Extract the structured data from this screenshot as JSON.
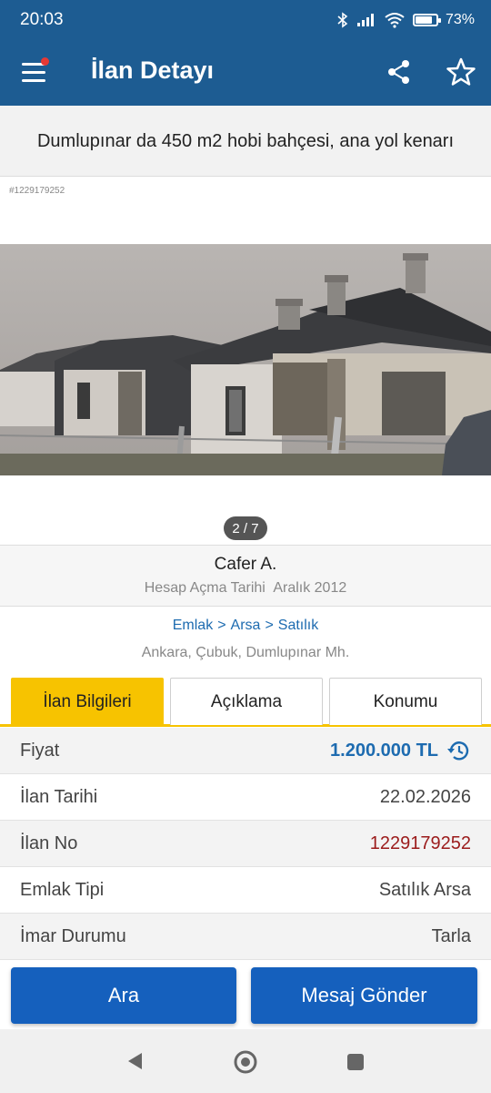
{
  "status_bar": {
    "time": "20:03",
    "battery": "73%"
  },
  "app_bar": {
    "title": "İlan Detayı"
  },
  "listing": {
    "title": "Dumlupınar da 450 m2 hobi bahçesi, ana yol kenarı",
    "id_tag": "#1229179252",
    "photo_counter": "2 / 7"
  },
  "seller": {
    "name": "Cafer A.",
    "since_label": "Hesap Açma Tarihi",
    "since_value": "Aralık 2012"
  },
  "breadcrumb": [
    "Emlak",
    "Arsa",
    "Satılık"
  ],
  "breadcrumb_sep": ">",
  "location": "Ankara, Çubuk, Dumlupınar Mh.",
  "tabs": [
    {
      "label": "İlan Bilgileri",
      "active": true
    },
    {
      "label": "Açıklama",
      "active": false
    },
    {
      "label": "Konumu",
      "active": false
    }
  ],
  "info_rows": [
    {
      "key": "Fiyat",
      "value": "1.200.000 TL"
    },
    {
      "key": "İlan Tarihi",
      "value": "22.02.2026"
    },
    {
      "key": "İlan No",
      "value": "1229179252"
    },
    {
      "key": "Emlak Tipi",
      "value": "Satılık Arsa"
    },
    {
      "key": "İmar Durumu",
      "value": "Tarla"
    }
  ],
  "actions": {
    "call": "Ara",
    "message": "Mesaj Gönder"
  },
  "colors": {
    "primary": "#1d5c92",
    "accent": "#f7c300",
    "button": "#1560bd",
    "price": "#1d6bb0",
    "listing_no": "#9b1b1b"
  },
  "icons": [
    "menu-icon",
    "share-icon",
    "star-icon",
    "price-history-icon",
    "back-icon",
    "home-icon",
    "recents-icon"
  ]
}
